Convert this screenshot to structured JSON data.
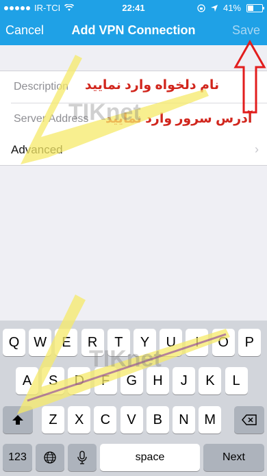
{
  "status_bar": {
    "carrier": "IR-TCI",
    "time": "22:41",
    "battery": "41%",
    "battery_level": 0.41
  },
  "nav": {
    "cancel": "Cancel",
    "title": "Add VPN Connection",
    "save": "Save"
  },
  "form": {
    "description_label": "Description",
    "description_hint": "نام دلخواه وارد نمایید",
    "server_label": "Server Address",
    "server_hint": "آدرس سرور وارد نمایید",
    "advanced": "Advanced"
  },
  "keyboard": {
    "row1": [
      "Q",
      "W",
      "E",
      "R",
      "T",
      "Y",
      "U",
      "I",
      "O",
      "P"
    ],
    "row2": [
      "A",
      "S",
      "D",
      "F",
      "G",
      "H",
      "J",
      "K",
      "L"
    ],
    "row3": [
      "Z",
      "X",
      "C",
      "V",
      "B",
      "N",
      "M"
    ],
    "num": "123",
    "space": "space",
    "next": "Next"
  },
  "watermark": "TIKnet",
  "colors": {
    "nav_bg": "#1fa1e6",
    "hint_red": "#d1261d",
    "keyboard_bg": "#d2d5db"
  }
}
